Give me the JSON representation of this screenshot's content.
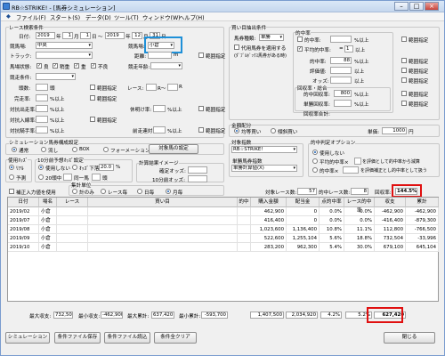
{
  "window": {
    "title": "RB☆STRIKE! - [馬券シミュレーション]"
  },
  "menu": [
    "ファイル(F)",
    "スタート(S)",
    "データ(D)",
    "ツール(T)",
    "ウィンドウ(W)",
    "ヘルプ(H)"
  ],
  "race": {
    "group": "レース検索条件",
    "date_label": "日付:",
    "from": {
      "year": "2019",
      "month": "1",
      "day": "1"
    },
    "to": {
      "year": "2019",
      "month": "12",
      "day": "31"
    },
    "sep": "〜",
    "y": "年",
    "m": "月",
    "d": "日",
    "venue_label": "競馬場:",
    "venue": "中央",
    "course_label": "競馬場:",
    "course": "小倉",
    "track_label": "トラック:",
    "track": "",
    "dist_label": "距離:",
    "dist_unit": "m",
    "range": "範囲指定",
    "cond_label": "馬場状態:",
    "cond": [
      "良",
      "稍重",
      "重",
      "不良"
    ],
    "age_label": "競走年齢:",
    "class_label": "競走条件:",
    "entry_label": "頭数:",
    "entry_unit": "頭",
    "race_label": "レース:",
    "race_r1": "R〜",
    "race_r2": "R",
    "result_label": "完走率:",
    "odds_label": "対抗出走率:",
    "cancel_label": "休明け率:",
    "odds2_label": "対抗入線率:",
    "odds3_label": "対抗騎手率:",
    "odds4_label": "前走連対:",
    "pct": "%以上",
    "spec": "範囲指定"
  },
  "bet": {
    "group": "買い目抽出条件",
    "type_label": "馬券種類:",
    "type": "単勝",
    "opt1": "代用馬券を適用する",
    "opt1b": "(ﾀﾞﾌﾞﾙﾎﾞｯｸｽ馬券がある時)",
    "hit_group": "的中率",
    "hit_label": "的中率:",
    "avg_label": "平均的中率:",
    "eval_label": "評価値:",
    "odds_label": "オッズ:",
    "ret_group": "回収率・総合",
    "ret1": "総回収率:",
    "ret2": "的中回収率:",
    "ret3": "単勝回収率:",
    "ret4": "回収率合計:",
    "above": "以上",
    "pct": "%以上",
    "spec": "範囲指定",
    "eq": "=",
    "v88": "88",
    "v800": "800",
    "v1": "1"
  },
  "funds": {
    "group": "金額配分",
    "opt1": "均等買い",
    "opt2": "傾斜買い",
    "unit_label": "単価:",
    "unit": "1000",
    "yen": "円"
  },
  "sim": {
    "group": "シミュレーション馬券構成設定",
    "mode1": "通常",
    "mode2": "流し",
    "mode3": "BOX",
    "mode4": "フォーメーション",
    "btn": "対象馬の設定",
    "method_group": "使用ｵｯｽﾞ",
    "m1": "ﾘｱﾙ",
    "m2": "予測",
    "lim_group": "10分前予想ｵｯｽﾞ設定",
    "lim1": "使用しない",
    "lim1b": "ｵｯｽﾞ下落",
    "lim_v": "20.0",
    "lim_pct": "%",
    "lim2": "20頭中",
    "lim2b": "同一馬",
    "lim2c": "頭",
    "img_group": "計算結果イメージ",
    "img1": "確定オッズ:",
    "img2": "10分前オッズ:",
    "fix": "補正入力値を使用",
    "agg_group": "集計単位",
    "agg": [
      "計のみ",
      "レース毎",
      "日毎",
      "月毎"
    ]
  },
  "target": {
    "group": "対象指数",
    "value": "RB☆STRIKE!",
    "sub_group": "単勝馬券指数",
    "sub": "単勝計算値(X)"
  },
  "judge": {
    "group": "的中判定オプション",
    "opt1": "使用しない",
    "opt2": "平均的中率×",
    "opt2b": "を評価として的中率から減算",
    "opt3": "的中率×",
    "opt3b": "を評価補正とし的中率として扱う"
  },
  "summary": {
    "races_label": "対象レース数:",
    "races": "57",
    "bets_label": "的中レース数:",
    "bets": "8",
    "rate_label": "回収率:",
    "rate": "144.5%"
  },
  "table": {
    "headers": [
      "日付",
      "場名",
      "レース",
      "買い目",
      "的中",
      "購入金額",
      "配当金",
      "点的中率",
      "レース的中率",
      "収支",
      "累計"
    ],
    "rows": [
      [
        "2019/02",
        "小倉",
        "",
        "",
        "",
        "462,900",
        "0",
        "0.0%",
        "0.0%",
        "-462,900",
        "-462,900"
      ],
      [
        "2019/07",
        "小倉",
        "",
        "",
        "",
        "416,400",
        "0",
        "0.0%",
        "0.0%",
        "-416,400",
        "-879,300"
      ],
      [
        "2019/08",
        "小倉",
        "",
        "",
        "",
        "1,023,600",
        "1,136,400",
        "10.8%",
        "11.1%",
        "112,800",
        "-766,500"
      ],
      [
        "2019/09",
        "小倉",
        "",
        "",
        "",
        "522,600",
        "1,255,104",
        "5.6%",
        "18.8%",
        "732,504",
        "-33,996"
      ],
      [
        "2019/10",
        "小倉",
        "",
        "",
        "",
        "283,200",
        "962,300",
        "5.4%",
        "30.0%",
        "679,100",
        "645,104"
      ]
    ]
  },
  "footer": {
    "items": [
      {
        "label": "最大収支:",
        "value": "732,504"
      },
      {
        "label": "最小収支:",
        "value": "-462,900"
      },
      {
        "label": "最大累計:",
        "value": "637,420"
      },
      {
        "label": "最小累計:",
        "value": "-593,700"
      }
    ],
    "total_buy": "1,407,500",
    "total_pay": "2,034,920",
    "total_hit": "4.2%",
    "total_race": "5.2%",
    "total_sum": "627,420"
  },
  "buttons": {
    "sim": "シミュレーション",
    "save": "条件ファイル保存",
    "load": "条件ファイル読込",
    "clear": "条件全クリア",
    "close": "閉じる"
  },
  "colors": {
    "highlight_blue": "#1e90d8",
    "highlight_red": "#e01010"
  }
}
